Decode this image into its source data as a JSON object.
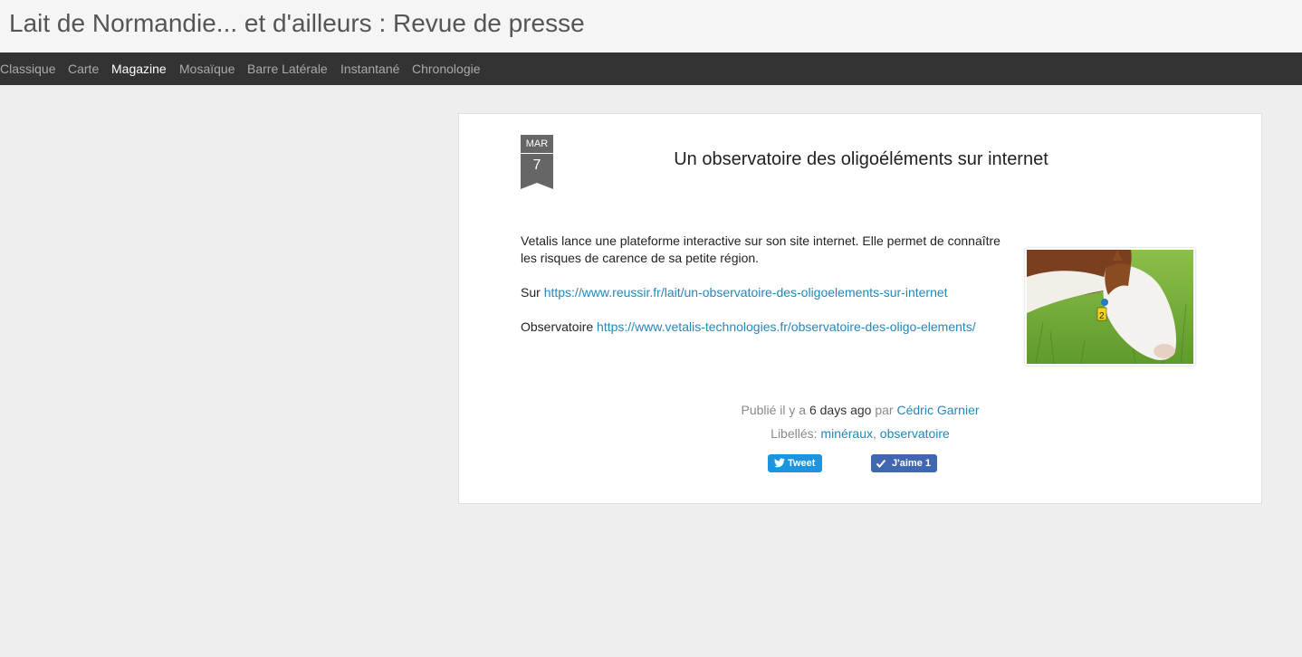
{
  "site": {
    "title": "Lait de Normandie... et d'ailleurs : Revue de presse"
  },
  "nav": {
    "items": [
      {
        "label": "Classique"
      },
      {
        "label": "Carte"
      },
      {
        "label": "Magazine"
      },
      {
        "label": "Mosaïque"
      },
      {
        "label": "Barre Latérale"
      },
      {
        "label": "Instantané"
      },
      {
        "label": "Chronologie"
      }
    ],
    "active": "Magazine"
  },
  "post": {
    "date": {
      "month": "Mar",
      "day": "7"
    },
    "title": "Un observatoire des oligoéléments sur internet",
    "intro": "Vetalis lance une plateforme interactive sur son site internet. Elle permet de connaître les risques de carence de sa petite région.",
    "source_prefix": "Sur",
    "source_link": "https://www.reussir.fr/lait/un-observatoire-des-oligoelements-sur-internet",
    "obs_prefix": "Observatoire",
    "obs_link": "https://www.vetalis-technologies.fr/observatoire-des-oligo-elements/",
    "image_ear_tag": "2",
    "meta": {
      "published_prefix": "Publié il y a",
      "published_ago": "6 days ago",
      "by": "par",
      "author": "Cédric Garnier",
      "labels_prefix": "Libellés:",
      "labels": [
        "minéraux",
        "observatoire"
      ],
      "label_sep": ","
    },
    "share": {
      "tweet_label": "Tweet",
      "like_label": "J'aime 1"
    }
  },
  "colors": {
    "nav_bg": "#333333",
    "link": "#2288bb",
    "tweet": "#1b95e0",
    "like": "#4267b2",
    "date_badge": "#666666"
  }
}
